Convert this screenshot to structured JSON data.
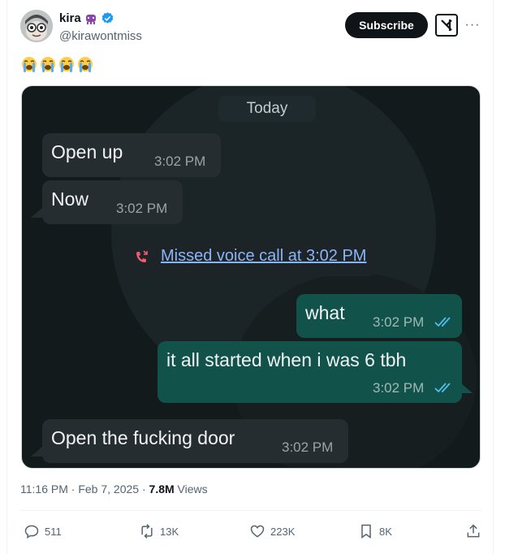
{
  "author": {
    "display_name": "kira",
    "handle": "@kirawontmiss"
  },
  "header": {
    "subscribe_label": "Subscribe",
    "more_label": "···"
  },
  "tweet": {
    "emojis": [
      "😭",
      "😭",
      "😭",
      "😭"
    ]
  },
  "chat": {
    "date_chip": "Today",
    "messages": [
      {
        "direction": "in",
        "text": "Open up",
        "time": "3:02 PM"
      },
      {
        "direction": "in",
        "text": "Now",
        "time": "3:02 PM"
      },
      {
        "direction": "out",
        "text": "what",
        "time": "3:02 PM"
      },
      {
        "direction": "out",
        "text": "it all started when i was 6 tbh",
        "time": "3:02 PM"
      },
      {
        "direction": "in",
        "text": "Open the fucking door",
        "time": "3:02 PM"
      }
    ],
    "missed_call": "Missed voice call at 3:02 PM"
  },
  "meta": {
    "time": "11:16 PM",
    "separator": "·",
    "date": "Feb 7, 2025",
    "views_count": "7.8M",
    "views_label": "Views"
  },
  "actions": {
    "replies": "511",
    "reposts": "13K",
    "likes": "223K",
    "bookmarks": "8K"
  },
  "colors": {
    "accent": "#1d9bf0",
    "incoming_bubble": "#262d30",
    "outgoing_bubble": "#11524a",
    "link_blue": "#8ab4f8",
    "missed_red": "#f15c6d"
  }
}
